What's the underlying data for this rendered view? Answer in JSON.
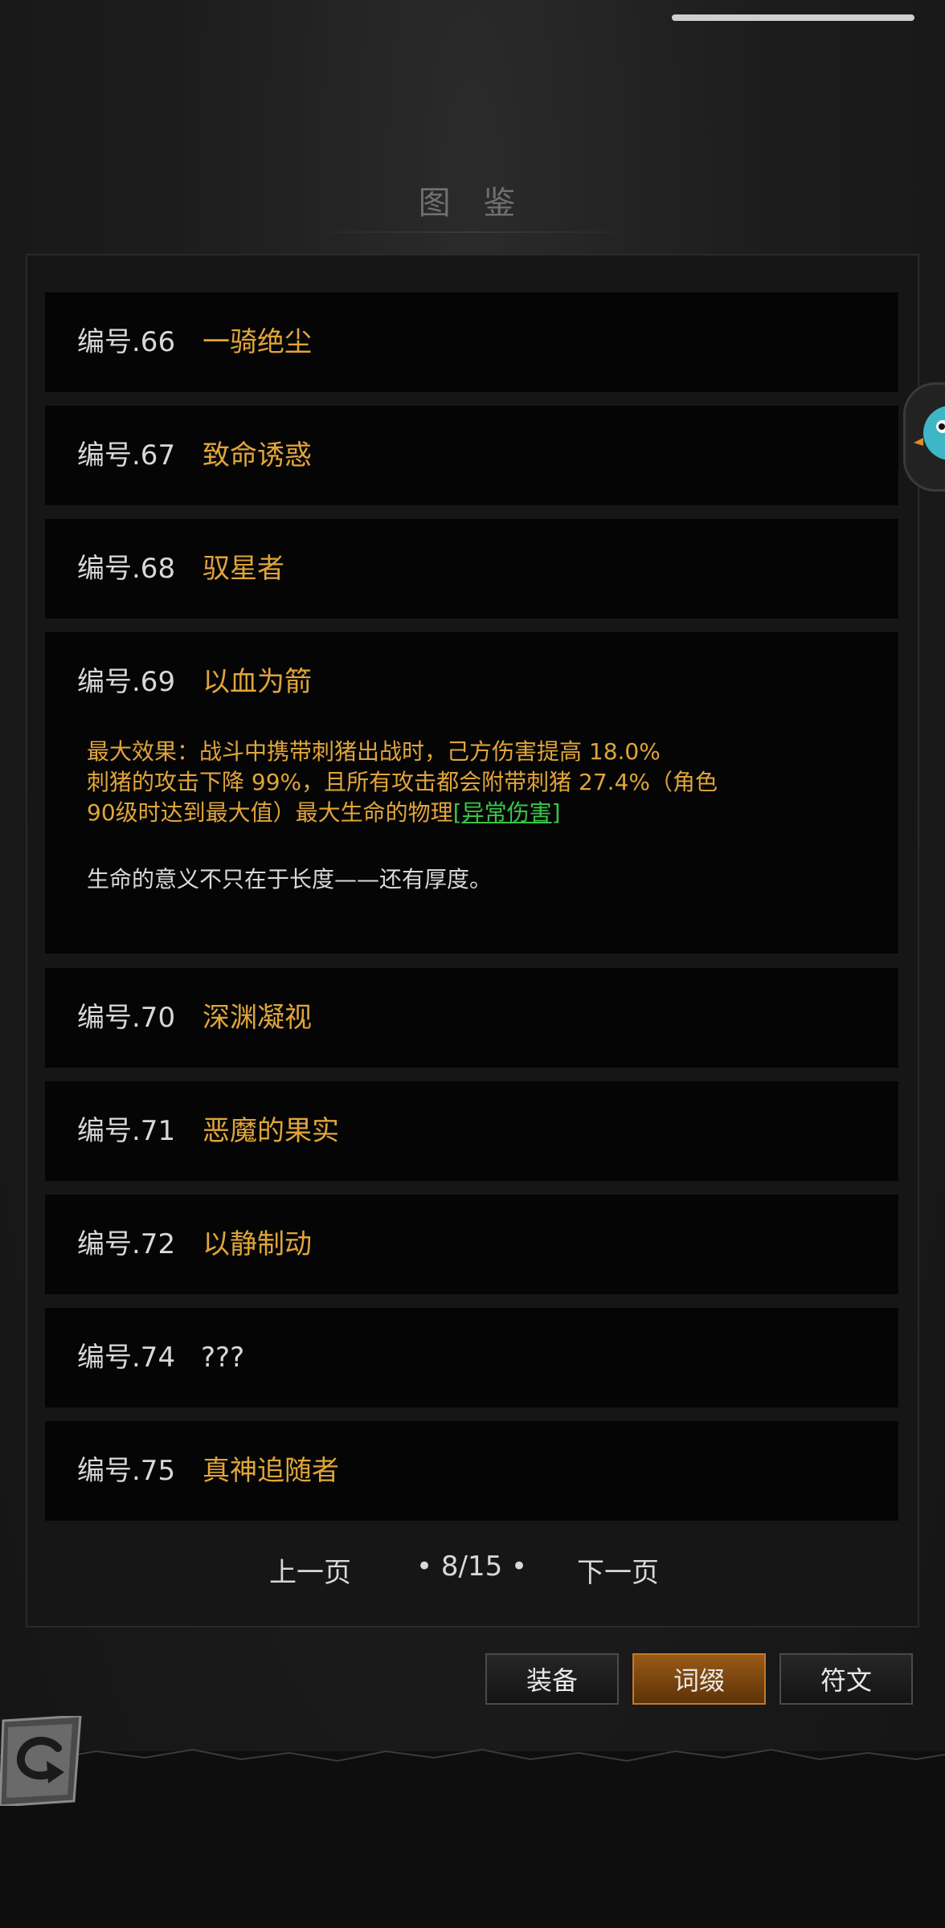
{
  "title": "图 鉴",
  "entries": [
    {
      "num": "编号.66",
      "name": "一骑绝尘"
    },
    {
      "num": "编号.67",
      "name": "致命诱惑"
    },
    {
      "num": "编号.68",
      "name": "驭星者"
    },
    {
      "num": "编号.69",
      "name": "以血为箭"
    },
    {
      "num": "编号.70",
      "name": "深渊凝视"
    },
    {
      "num": "编号.71",
      "name": "恶魔的果实"
    },
    {
      "num": "编号.72",
      "name": "以静制动"
    },
    {
      "num": "编号.74",
      "name": "???"
    },
    {
      "num": "编号.75",
      "name": "真神追随者"
    }
  ],
  "expanded": {
    "effect_line1": "最大效果：战斗中携带刺猪出战时，己方伤害提高 18.0%",
    "effect_line2": "刺猪的攻击下降 99%，且所有攻击都会附带刺猪 27.4%（角色",
    "effect_line3": "90级时达到最大值）最大生命的物理",
    "effect_link": "[异常伤害]",
    "flavor": "生命的意义不只在于长度——还有厚度。"
  },
  "pager": {
    "prev": "上一页",
    "page": "• 8/15 •",
    "next": "下一页"
  },
  "tabs": [
    "装备",
    "词缀",
    "符文"
  ],
  "active_tab": "词缀",
  "colors": {
    "name_gold": "#e0a53a",
    "link_green": "#39c44a",
    "active_tab": "#9a5a16"
  },
  "icons": {
    "back": "back-arrow-icon",
    "float": "hedgehog-avatar-icon"
  }
}
